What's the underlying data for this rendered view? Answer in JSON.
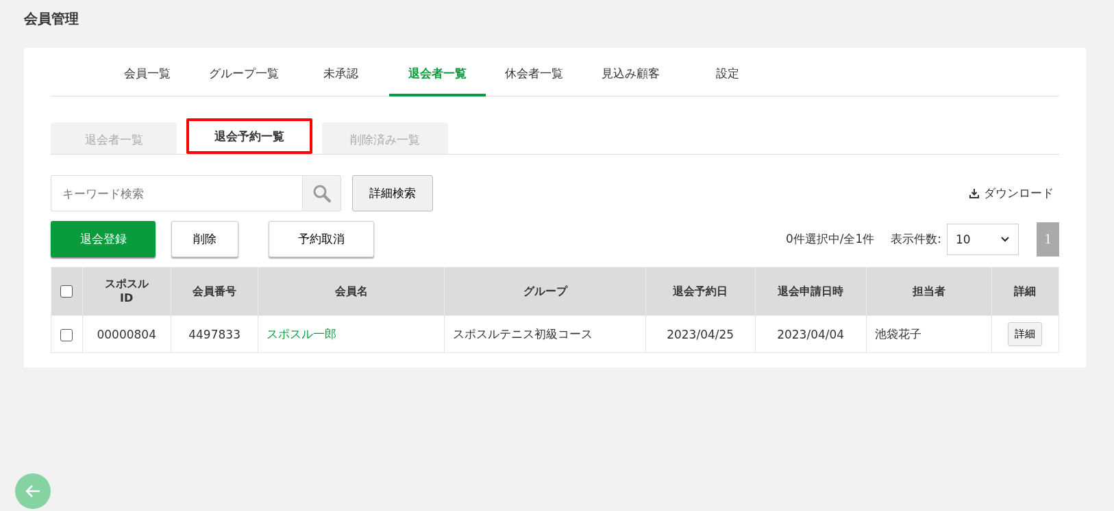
{
  "page_title": "会員管理",
  "tabs": [
    {
      "label": "会員一覧",
      "selected": false
    },
    {
      "label": "グループ一覧",
      "selected": false
    },
    {
      "label": "未承認",
      "selected": false
    },
    {
      "label": "退会者一覧",
      "selected": true
    },
    {
      "label": "休会者一覧",
      "selected": false
    },
    {
      "label": "見込み顧客",
      "selected": false
    },
    {
      "label": "設定",
      "selected": false
    }
  ],
  "subtabs": [
    {
      "label": "退会者一覧",
      "selected": false
    },
    {
      "label": "退会予約一覧",
      "selected": true
    },
    {
      "label": "削除済み一覧",
      "selected": false
    }
  ],
  "search": {
    "placeholder": "キーワード検索"
  },
  "advanced_search_button": "詳細検索",
  "download_link": "ダウンロード",
  "buttons": [
    {
      "label": "退会登録",
      "kind": "primary"
    },
    {
      "label": "削除",
      "kind": "plain"
    },
    {
      "label": "予約取消",
      "kind": "plain"
    }
  ],
  "selection_count": "0件選択中/全1件",
  "page_size_label": "表示件数:",
  "page_size": "10",
  "pages": [
    {
      "label": "1",
      "selected": true
    }
  ],
  "table": {
    "select_all_checked": false,
    "columns": [
      "スポスル\nID",
      "会員番号",
      "会員名",
      "グループ",
      "退会予約日",
      "退会申請日時",
      "担当者",
      "詳細"
    ],
    "rows": [
      {
        "checked": false,
        "cells": [
          "00000804",
          "4497833",
          "スポスル一郎",
          "スポスルテニス初級コース",
          "2023/04/25",
          "2023/04/04",
          "池袋花子"
        ],
        "detail_button": "詳細"
      }
    ]
  }
}
